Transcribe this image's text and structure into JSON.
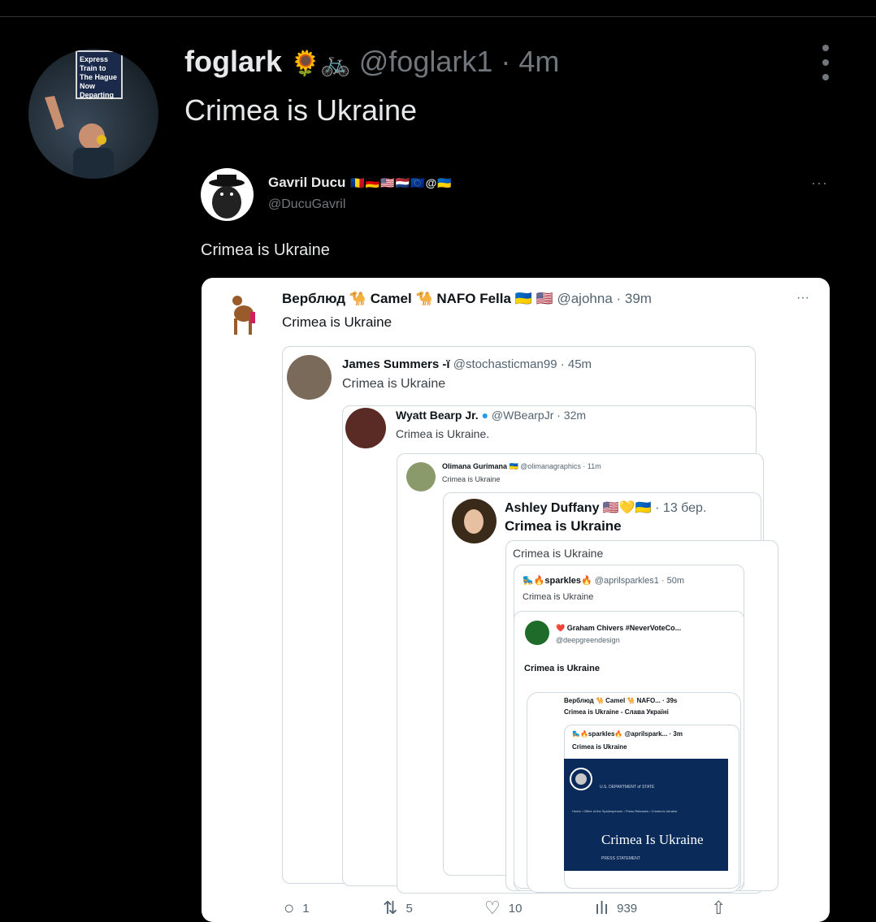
{
  "tweet": {
    "name": "foglark",
    "emojis": "🌻🚲",
    "handle": "@foglark1 · 4m",
    "text": "Crimea is Ukraine",
    "avatar_sign": [
      "Express",
      "Train to",
      "The Hague",
      "Now",
      "Departing"
    ]
  },
  "quoted": {
    "name": "Gavril Ducu",
    "flags": "🇷🇴🇩🇪🇺🇸🇳🇱🇪🇺@🇺🇦",
    "handle": "@DucuGavril",
    "text": "Crimea is Ukraine",
    "more": "···"
  },
  "screenshot": {
    "camel": {
      "name": "Верблюд 🐪 Camel 🐪 NAFO Fella 🇺🇦 🇺🇸",
      "handle": "@ajohna · 39m",
      "text": "Crimea is Ukraine"
    },
    "james": {
      "name": "James Summers -ï",
      "handle": "@stochasticman99 · 45m",
      "text": "Crimea is Ukraine"
    },
    "wyatt": {
      "name": "Wyatt Bearp Jr.",
      "handle": "@WBearpJr · 32m",
      "text": "Crimea is Ukraine."
    },
    "olimana": {
      "name": "Olimana Gurimana 🇺🇦",
      "handle": "@olimanagraphics · 11m",
      "text": "Crimea is Ukraine"
    },
    "ashley": {
      "name": "Ashley Duffany 🇺🇸💛🇺🇦",
      "handle": "· 13 бер.",
      "text": "Crimea is Ukraine"
    },
    "ashley_sub": "Crimea is Ukraine",
    "sparkles": {
      "name": "🛼🔥sparkles🔥",
      "handle": "@aprilsparkles1 · 50m",
      "text": "Crimea is Ukraine"
    },
    "graham": {
      "name": "❤️ Graham Chivers #NeverVoteCo...",
      "handle": "@deepgreendesign",
      "text": "Crimea is Ukraine"
    },
    "camel2": {
      "name": "Верблюд 🐪 Camel 🐪 NAFO... · 39s",
      "text": "Crimea is Ukraine - Слава Україні"
    },
    "sparkles2": {
      "name": "🛼🔥sparkles🔥 @aprilspark... · 3m",
      "text": "Crimea is Ukraine"
    },
    "statedept": {
      "dept": "U.S. DEPARTMENT of STATE",
      "breadcrumb": "Home › Office of the Spokesperson › Press Releases › Crimea is Ukraine",
      "title": "Crimea Is Ukraine",
      "sub": "PRESS STATEMENT"
    },
    "actions": {
      "replies": "1",
      "reposts": "5",
      "likes": "10",
      "views": "939"
    }
  }
}
